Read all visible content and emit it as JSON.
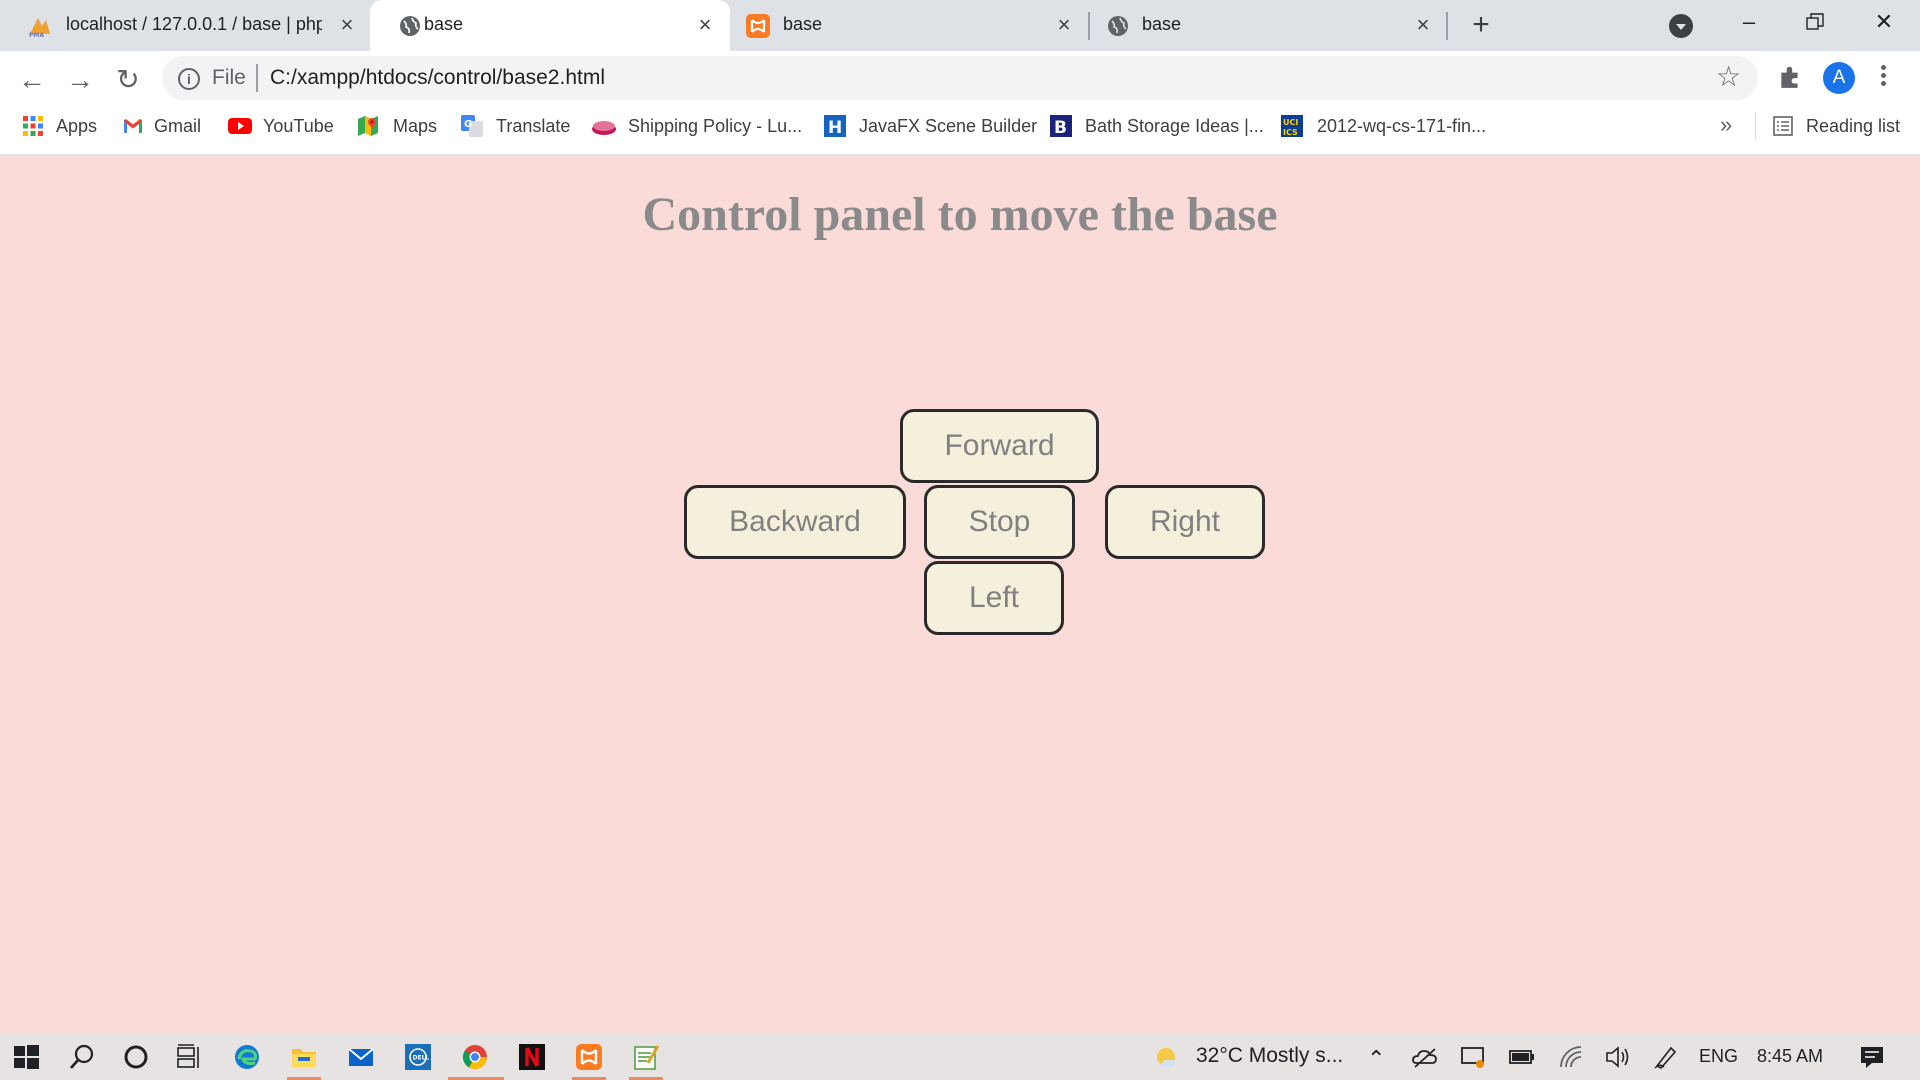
{
  "browser": {
    "tabs": [
      {
        "title": "localhost / 127.0.0.1 / base | phpMyAdmin",
        "icon": "phpmyadmin-icon",
        "active": false
      },
      {
        "title": "base",
        "icon": "globe-icon",
        "active": true
      },
      {
        "title": "base",
        "icon": "xampp-icon",
        "active": false
      },
      {
        "title": "base",
        "icon": "globe-icon",
        "active": false
      }
    ],
    "new_tab_label": "+",
    "address": {
      "scheme_label": "File",
      "url": "C:/xampp/htdocs/control/base2.html"
    },
    "profile_initial": "A",
    "bookmarks": [
      {
        "label": "Apps",
        "icon": "apps-grid-icon"
      },
      {
        "label": "Gmail",
        "icon": "gmail-icon"
      },
      {
        "label": "YouTube",
        "icon": "youtube-icon"
      },
      {
        "label": "Maps",
        "icon": "maps-icon"
      },
      {
        "label": "Translate",
        "icon": "translate-icon"
      },
      {
        "label": "Shipping Policy - Lu...",
        "icon": "shipping-icon"
      },
      {
        "label": "JavaFX Scene Builder",
        "icon": "h-logo-icon"
      },
      {
        "label": "Bath Storage Ideas |...",
        "icon": "b-logo-icon"
      },
      {
        "label": "2012-wq-cs-171-fin...",
        "icon": "uci-ics-icon"
      }
    ],
    "bookmarks_overflow": "»",
    "reading_list_label": "Reading list"
  },
  "page": {
    "title": "Control panel to move the base",
    "buttons": {
      "forward": "Forward",
      "backward": "Backward",
      "stop": "Stop",
      "right": "Right",
      "left": "Left"
    },
    "colors": {
      "background": "#fadbd8",
      "button_fill": "#f5f0dc",
      "text": "#808080"
    }
  },
  "taskbar": {
    "weather": "32°C  Mostly s...",
    "language": "ENG",
    "time": "8:45 AM"
  }
}
